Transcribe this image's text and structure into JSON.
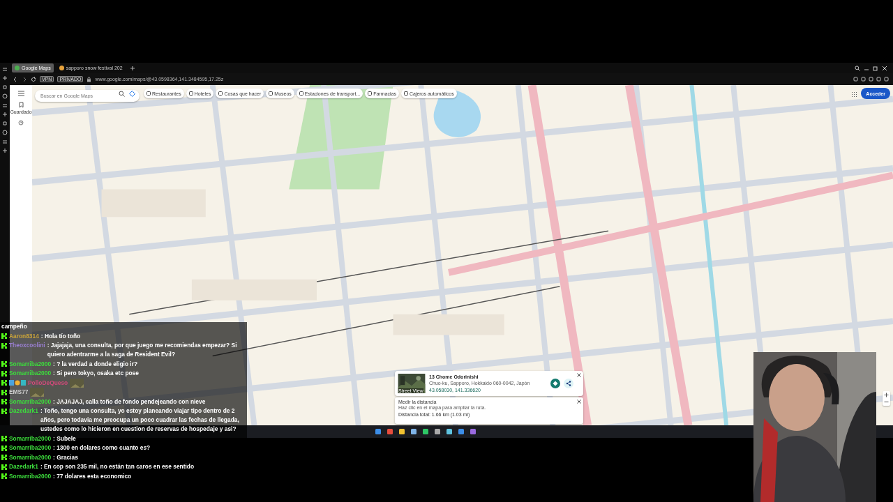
{
  "browser": {
    "tabs": [
      {
        "label": "Google Maps",
        "selected": true
      },
      {
        "label": "sapporo snow festival 202",
        "selected": false
      }
    ],
    "badges": [
      "VPN",
      "PRIVADO"
    ],
    "address": "www.google.com/maps/@43.0598364,141.3484595,17.25z"
  },
  "maps": {
    "saved_label": "Guardado",
    "search": {
      "placeholder": "Buscar en Google Maps"
    },
    "chips": [
      "Restaurantes",
      "Hoteles",
      "Cosas que hacer",
      "Museos",
      "Estaciones de transport...",
      "Farmacias",
      "Cajeros automáticos"
    ],
    "sign_in": "Acceder",
    "place_card": {
      "title": "13 Chome Odorinishi",
      "address": "Chuo-ku, Sapporo, Hokkaido 060-0042, Japón",
      "coords": "43.058030, 141.336620",
      "street_view": "Street View"
    },
    "distance_card": {
      "title": "Medir la distancia",
      "hint": "Haz clic en el mapa para ampliar la ruta.",
      "total": "Distancia total: 1.66 km (1.03 mi)"
    }
  },
  "chat": [
    {
      "kind": "continuation",
      "text": "campeño"
    },
    {
      "kind": "message",
      "user": "Aaron8314",
      "color": "#c8a23a",
      "text": ": Hola tío toño"
    },
    {
      "kind": "message",
      "user": "Theoxcoolini",
      "color": "#9a7fd1",
      "text": ": Jajajaja, una consulta, por que juego me recomiendas empezar? Si quiero adentrarme a la saga de Resident Evil?"
    },
    {
      "kind": "message",
      "user": "Somarriba2000",
      "color": "#3ddc3d",
      "text": ": ? la verdad a donde eligio ir?"
    },
    {
      "kind": "message",
      "user": "Somarriba2000",
      "color": "#3ddc3d",
      "text": ": Si pero tokyo, osaka etc pose"
    },
    {
      "kind": "emote",
      "user": "PolloDeQueso",
      "color": "#d04a7a"
    },
    {
      "kind": "emote",
      "user": "EMS77",
      "color": "#cfcfcf"
    },
    {
      "kind": "message",
      "user": "Somarriba2000",
      "color": "#3ddc3d",
      "text": ": JAJAJAJ, calla toño de fondo pendejeando con nieve"
    },
    {
      "kind": "message",
      "user": "Dazedark1",
      "color": "#3ddc3d",
      "text": ": Toño, tengo una consulta, yo estoy planeando viajar tipo dentro de 2 años, pero todavia me preocupa un poco cuadrar las fechas de llegada, ustedes como lo hicieron en cuestion de reservas de hospedaje y asi?"
    },
    {
      "kind": "message",
      "user": "Somarriba2000",
      "color": "#3ddc3d",
      "text": ": Subele"
    },
    {
      "kind": "message",
      "user": "Somarriba2000",
      "color": "#3ddc3d",
      "text": ": 1300 en dolares como cuanto es?"
    },
    {
      "kind": "message",
      "user": "Somarriba2000",
      "color": "#3ddc3d",
      "text": ": Gracias"
    },
    {
      "kind": "message",
      "user": "Dazedark1",
      "color": "#3ddc3d",
      "text": ": En cop son 235 mil, no están tan caros en ese sentido"
    },
    {
      "kind": "message",
      "user": "Somarriba2000",
      "color": "#3ddc3d",
      "text": ": 77 dolares esta economico"
    }
  ]
}
